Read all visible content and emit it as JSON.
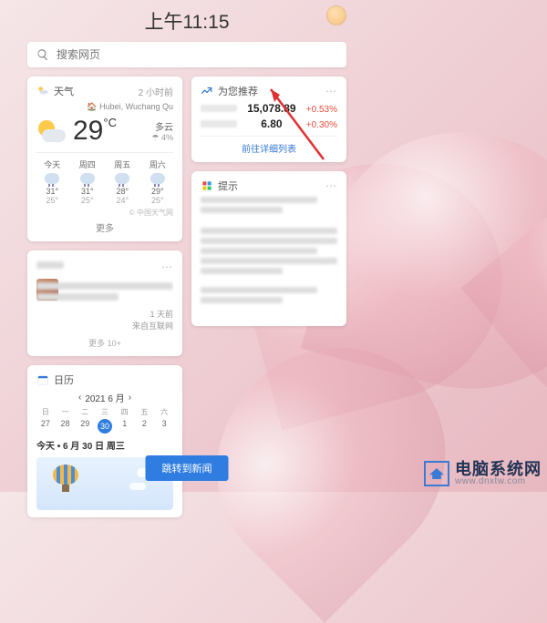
{
  "time": "上午11:15",
  "search": {
    "placeholder": "搜索网页"
  },
  "weather": {
    "title": "天气",
    "timestamp": "2 小时前",
    "location": "Hubei, Wuchang Qu",
    "temp": "29",
    "temp_unit": "°C",
    "condition": "多云",
    "feels": "☂ 4%",
    "days": [
      {
        "label": "今天",
        "hi": "31°",
        "lo": "25°"
      },
      {
        "label": "周四",
        "hi": "31°",
        "lo": "25°"
      },
      {
        "label": "周五",
        "hi": "28°",
        "lo": "24°"
      },
      {
        "label": "周六",
        "hi": "29°",
        "lo": "25°"
      }
    ],
    "source": "© 中国天气网",
    "more": "更多"
  },
  "stocks": {
    "title": "为您推荐",
    "rows": [
      {
        "value": "15,078.89",
        "change": "+0.53%",
        "dir": "up"
      },
      {
        "value": "6.80",
        "change": "+0.30%",
        "dir": "up"
      }
    ],
    "link": "前往详细列表"
  },
  "tips": {
    "title": "提示"
  },
  "news": {
    "meta_line1": "1 天前",
    "meta_line2": "来自互联网",
    "footer": "更多 10+"
  },
  "calendar": {
    "title": "日历",
    "month": "2021 6 月",
    "dow": [
      "日",
      "一",
      "二",
      "三",
      "四",
      "五",
      "六"
    ],
    "row_offset": [
      "27",
      "28",
      "29",
      "30",
      "1",
      "2",
      "3"
    ],
    "today_val": "30",
    "today_label": "今天 • 6 月 30 日 周三"
  },
  "jump_button": "跳转到新闻",
  "watermark": {
    "cn": "电脑系统网",
    "url": "www.dnxtw.com"
  }
}
